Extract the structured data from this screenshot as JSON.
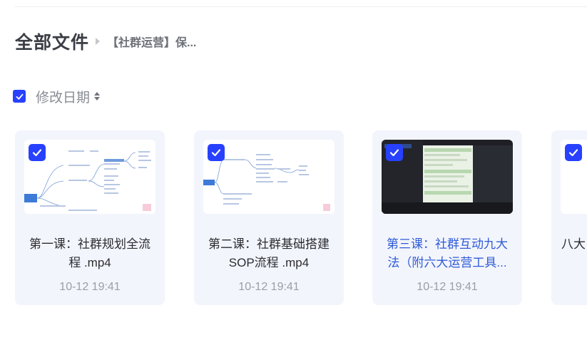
{
  "breadcrumb": {
    "root": "全部文件",
    "current": "【社群运营】保..."
  },
  "sort": {
    "label": "修改日期"
  },
  "files": [
    {
      "title": "第一课：社群规划全流程 .mp4",
      "date": "10-12 19:41",
      "selected": true
    },
    {
      "title": "第二课：社群基础搭建SOP流程 .mp4",
      "date": "10-12 19:41",
      "selected": true
    },
    {
      "title": "第三课：社群互动九大法（附六大运营工具...",
      "date": "10-12 19:41",
      "selected": true,
      "highlighted": true
    },
    {
      "title": "八大",
      "date": "",
      "selected": true
    }
  ],
  "colors": {
    "accent": "#2741ff",
    "link": "#2f5bd6",
    "card_bg": "#f3f5fd"
  },
  "icons": {
    "checkbox": "checkmark-icon",
    "sort": "sort-arrows-icon",
    "separator": "breadcrumb-caret-icon"
  }
}
